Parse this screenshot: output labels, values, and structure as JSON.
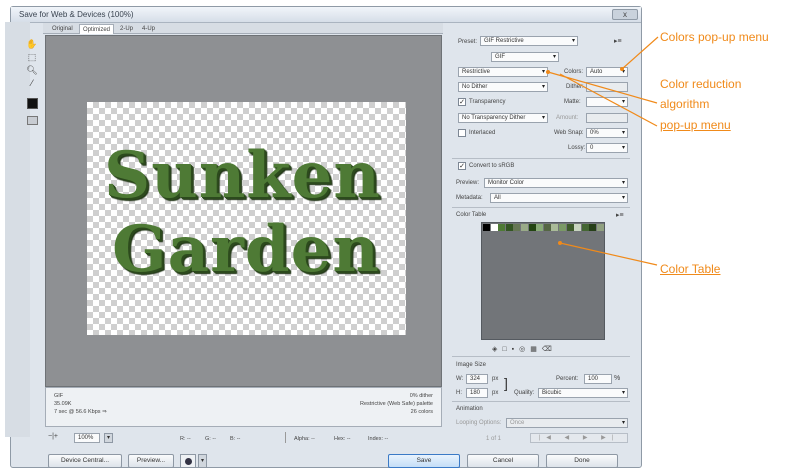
{
  "window": {
    "title": "Save for Web & Devices (100%)",
    "close_label": "x"
  },
  "toolbox": {
    "tools": [
      "hand-tool",
      "slice-select-tool",
      "zoom-tool",
      "eyedropper-tool"
    ],
    "eyedropper_color": "#111111"
  },
  "tabs": [
    "Original",
    "Optimized",
    "2-Up",
    "4-Up"
  ],
  "canvas": {
    "line1": "Sunken",
    "line2": "Garden",
    "text_color": "#4e7a35"
  },
  "status": {
    "left": [
      "GIF",
      "35.09K",
      "7 sec @ 56.6 Kbps  ⇒"
    ],
    "right": [
      "0% dither",
      "Restrictive (Web Safe) palette",
      "26 colors"
    ]
  },
  "bottom_controls": {
    "zoom_value": "100%",
    "readouts": [
      "R: --",
      "G: --",
      "B: --",
      "Alpha: --",
      "Hex: --",
      "Index: --"
    ]
  },
  "buttons": {
    "device_central": "Device Central...",
    "preview": "Preview...",
    "save": "Save",
    "cancel": "Cancel",
    "done": "Done"
  },
  "settings": {
    "preset_label": "Preset:",
    "preset_value": "GIF Restrictive",
    "format_value": "GIF",
    "reduction_value": "Restrictive",
    "colors_label": "Colors:",
    "colors_value": "Auto",
    "dither_algo_value": "No Dither",
    "dither_label": "Dither:",
    "transparency_label": "Transparency",
    "matte_label": "Matte:",
    "trans_dither_value": "No Transparency Dither",
    "amount_label": "Amount:",
    "interlaced_label": "Interlaced",
    "web_snap_label": "Web Snap:",
    "web_snap_value": "0%",
    "lossy_label": "Lossy:",
    "lossy_value": "0",
    "convert_srgb_label": "Convert to sRGB",
    "preview_label": "Preview:",
    "preview_value": "Monitor Color",
    "metadata_label": "Metadata:",
    "metadata_value": "All",
    "color_table_label": "Color Table",
    "table_colors": [
      "#000000",
      "#ffffff",
      "#4e7a35",
      "#335522",
      "#667755",
      "#99aa88",
      "#224411",
      "#88aa77",
      "#556644",
      "#aabb99",
      "#7a9966",
      "#3d5a2a",
      "#c8d4c0",
      "#446633",
      "#263f18",
      "#90a080"
    ],
    "image_size_label": "Image Size",
    "width_label": "W:",
    "width_value": "324",
    "height_label": "H:",
    "height_value": "180",
    "unit_label": "px",
    "percent_label": "Percent:",
    "percent_value": "100",
    "quality_label": "Quality:",
    "quality_value": "Bicubic",
    "animation_label": "Animation",
    "looping_label": "Looping Options:",
    "looping_value": "Once",
    "frame_counter": "1 of 1"
  },
  "annotations": {
    "colors_popup": "Colors pop-up menu",
    "reduction_line1": "Color reduction",
    "reduction_line2": "algorithm",
    "reduction_line3": "pop-up menu",
    "color_table": "Color Table"
  },
  "colors": {
    "annotation": "#f08a1a",
    "dialog_bg": "#dfe5ec",
    "canvas_bg": "#8e9093"
  }
}
